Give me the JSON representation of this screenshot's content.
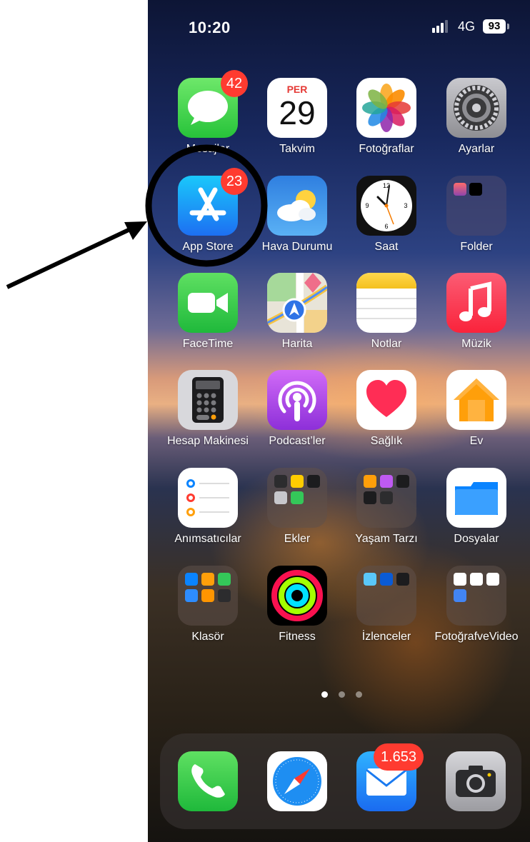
{
  "status": {
    "time": "10:20",
    "network": "4G",
    "battery": "93"
  },
  "apps": {
    "mesajlar": {
      "label": "Mesajlar",
      "badge": "42"
    },
    "takvim": {
      "label": "Takvim",
      "day_name": "PER",
      "day_number": "29"
    },
    "fotograflar": {
      "label": "Fotoğraflar"
    },
    "ayarlar": {
      "label": "Ayarlar"
    },
    "appstore": {
      "label": "App Store",
      "badge": "23"
    },
    "havadurumu": {
      "label": "Hava Durumu"
    },
    "saat": {
      "label": "Saat"
    },
    "folder": {
      "label": "Folder"
    },
    "facetime": {
      "label": "FaceTime"
    },
    "harita": {
      "label": "Harita"
    },
    "notlar": {
      "label": "Notlar"
    },
    "muzik": {
      "label": "Müzik"
    },
    "hesap": {
      "label": "Hesap Makinesi"
    },
    "podcast": {
      "label": "Podcast’ler"
    },
    "saglik": {
      "label": "Sağlık"
    },
    "ev": {
      "label": "Ev"
    },
    "animsaticilar": {
      "label": "Anımsatıcılar"
    },
    "ekler": {
      "label": "Ekler"
    },
    "yasamtarzi": {
      "label": "Yaşam Tarzı"
    },
    "dosyalar": {
      "label": "Dosyalar"
    },
    "klasor": {
      "label": "Klasör"
    },
    "fitness": {
      "label": "Fitness"
    },
    "izlenceler": {
      "label": "İzlenceler"
    },
    "fotografvevideo": {
      "label": "FotoğrafveVideo"
    }
  },
  "dock": {
    "mail_badge": "1.653"
  },
  "page_dots": {
    "count": 3,
    "active": 1
  },
  "colors": {
    "badge": "#ff3b30",
    "annotation": "#000000"
  }
}
